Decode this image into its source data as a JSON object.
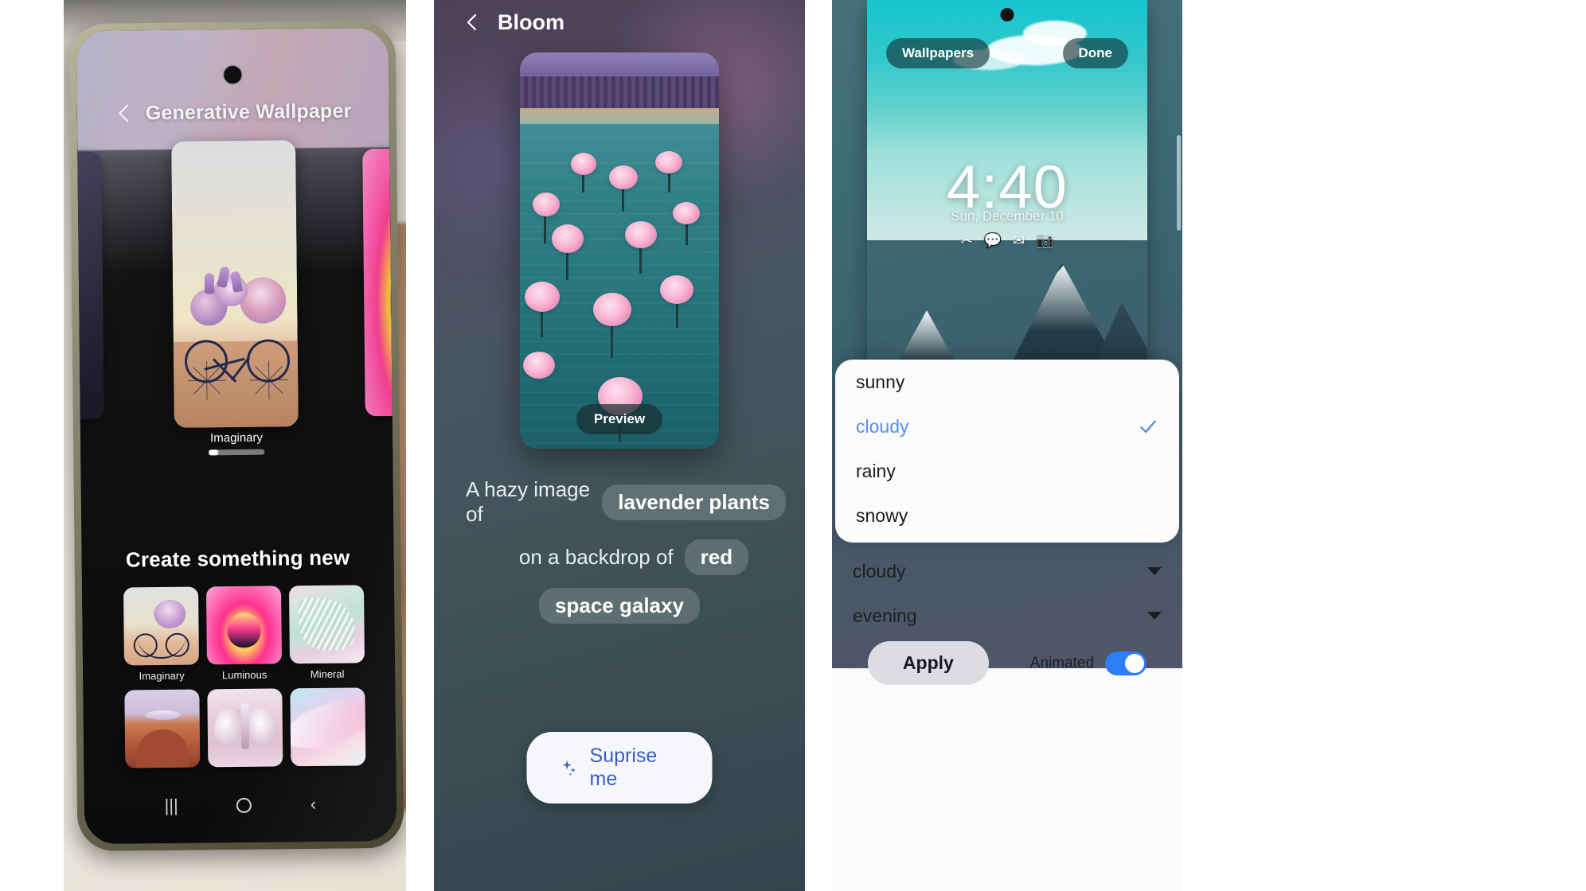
{
  "panel1": {
    "name": "generative-wallpaper-photo",
    "header": {
      "back_icon": "chevron-left-icon",
      "title": "Generative Wallpaper"
    },
    "carousel": {
      "current_label": "Imaginary"
    },
    "section_heading": "Create something new",
    "styles": [
      {
        "label": "Imaginary",
        "art": "bicycle-with-flowers"
      },
      {
        "label": "Luminous",
        "art": "glowing-flower"
      },
      {
        "label": "Mineral",
        "art": "crystal-shard"
      },
      {
        "label": "",
        "art": "canyon-arch"
      },
      {
        "label": "",
        "art": "moth"
      },
      {
        "label": "",
        "art": "silk-swirl"
      }
    ],
    "navbar": {
      "recents": "|||",
      "home": "home-circle-icon",
      "back": "chevron-left-icon"
    }
  },
  "panel2": {
    "name": "bloom-prompt-screen",
    "header": {
      "back_icon": "chevron-left-icon",
      "title": "Bloom"
    },
    "preview": {
      "badge": "Preview",
      "art": "cherry-blossom-lake"
    },
    "prompt": {
      "line1_text": "A hazy image of",
      "line1_chip": "lavender plants",
      "line2_text": "on a backdrop of",
      "line2_chip": "red",
      "line3_chip": "space galaxy"
    },
    "surprise_button": {
      "icon": "sparkles-icon",
      "label": "Suprise me",
      "color": "#3b5ecc"
    }
  },
  "panel3": {
    "name": "lockscreen-wallpaper-settings",
    "top_chips": {
      "left": "Wallpapers",
      "right": "Done"
    },
    "lockscreen": {
      "time": "4:40",
      "date": "Sun, December 10",
      "shortcut_icons": [
        "scissors-icon",
        "message-icon",
        "mail-icon",
        "camera-icon"
      ]
    },
    "dropdown": {
      "options": [
        {
          "label": "sunny",
          "selected": false
        },
        {
          "label": "cloudy",
          "selected": true
        },
        {
          "label": "rainy",
          "selected": false
        },
        {
          "label": "snowy",
          "selected": false
        }
      ],
      "selected_color": "#5b8dee",
      "check_icon": "check-icon"
    },
    "selects": [
      {
        "value": "cloudy",
        "caret": "chevron-down-icon"
      },
      {
        "value": "evening",
        "caret": "chevron-down-icon"
      }
    ],
    "apply_button": "Apply",
    "animated": {
      "label": "Animated",
      "on": true,
      "accent": "#2e7cf6"
    }
  }
}
